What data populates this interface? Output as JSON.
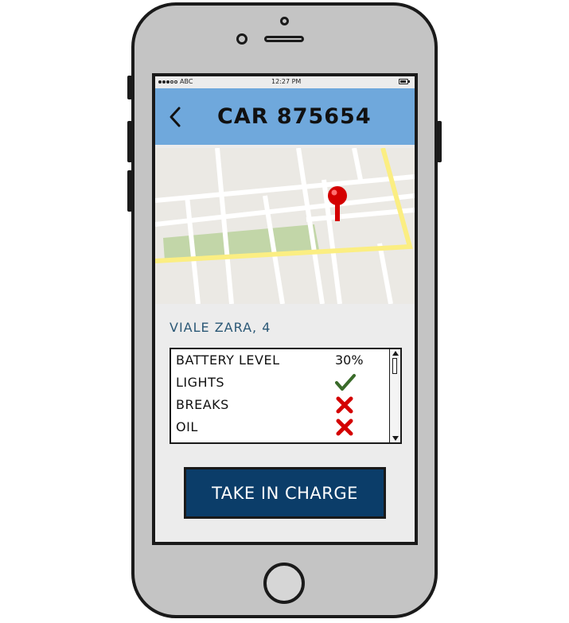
{
  "status_bar": {
    "carrier": "ABC",
    "time": "12:27 PM"
  },
  "header": {
    "title": "CAR 875654",
    "back_icon": "chevron-left-icon"
  },
  "map": {
    "pin_icon": "map-pin-icon",
    "park_color": "#c2d6a8",
    "road_color": "#ffffff",
    "main_road_color": "#fbee82",
    "pin_color": "#d40000"
  },
  "location": {
    "address": "VIALE ZARA, 4"
  },
  "checks": [
    {
      "label": "BATTERY LEVEL",
      "value": "30%"
    },
    {
      "label": "LIGHTS",
      "status": "ok",
      "icon": "checkmark-icon"
    },
    {
      "label": "BREAKS",
      "status": "fail",
      "icon": "cross-icon"
    },
    {
      "label": "OIL",
      "status": "fail",
      "icon": "cross-icon"
    }
  ],
  "action": {
    "button_label": "TAKE IN CHARGE"
  },
  "colors": {
    "header_bg": "#6fa8dc",
    "button_bg": "#0b3d69",
    "address_text": "#2b5876",
    "check_ok": "#3a6b2a",
    "check_fail": "#d40000"
  }
}
